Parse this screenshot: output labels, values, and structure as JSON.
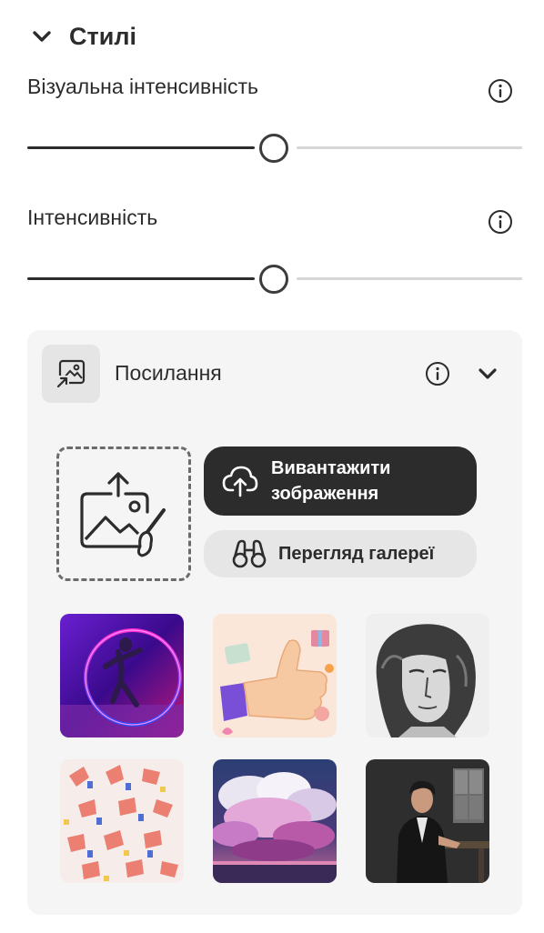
{
  "styles_section": {
    "title": "Стилі",
    "icon": "chevron-down-icon"
  },
  "visual_intensity": {
    "label": "Візуальна інтенсивність",
    "value": 0.5,
    "info_icon": "info-icon"
  },
  "intensity": {
    "label": "Інтенсивність",
    "value": 0.5,
    "info_icon": "info-icon"
  },
  "reference": {
    "title": "Посилання",
    "icon": "image-reference-icon",
    "upload_button": "Вивантажити зображення",
    "gallery_button": "Перегляд галереї",
    "thumbnails": [
      {
        "name": "neon-dancer"
      },
      {
        "name": "thumbs-up"
      },
      {
        "name": "engraving-portrait"
      },
      {
        "name": "hands-pattern"
      },
      {
        "name": "pink-clouds"
      },
      {
        "name": "man-portrait"
      }
    ]
  }
}
